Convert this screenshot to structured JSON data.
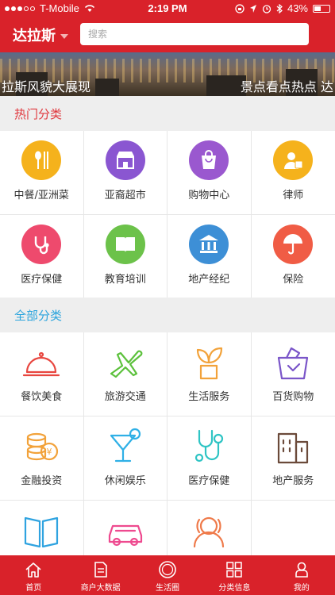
{
  "status": {
    "carrier": "T-Mobile",
    "time": "2:19 PM",
    "battery": "43%",
    "battery_level": 0.43
  },
  "header": {
    "city": "达拉斯",
    "search_placeholder": "搜索"
  },
  "banner": {
    "left_text": "拉斯风貌大展现",
    "right_text": "景点看点热点 达"
  },
  "hot": {
    "title": "热门分类",
    "title_color": "#e0383e",
    "items": [
      {
        "label": "中餐/亚洲菜",
        "icon": "spoon-chopsticks-icon",
        "color": "#f5b21c"
      },
      {
        "label": "亚裔超市",
        "icon": "store-icon",
        "color": "#8a56d1"
      },
      {
        "label": "购物中心",
        "icon": "shopping-bag-icon",
        "color": "#9a58cf"
      },
      {
        "label": "律师",
        "icon": "lawyer-icon",
        "color": "#f5b21c"
      },
      {
        "label": "医疗保健",
        "icon": "stethoscope-icon",
        "color": "#ee4a6d"
      },
      {
        "label": "教育培训",
        "icon": "book-icon",
        "color": "#6cc24a"
      },
      {
        "label": "地产经纪",
        "icon": "bank-icon",
        "color": "#3d8fd6"
      },
      {
        "label": "保险",
        "icon": "umbrella-icon",
        "color": "#f05c45"
      }
    ]
  },
  "all": {
    "title": "全部分类",
    "title_color": "#2aa4dd",
    "items": [
      {
        "label": "餐饮美食",
        "icon": "food-cloche-icon",
        "color": "#e8463f"
      },
      {
        "label": "旅游交通",
        "icon": "airplane-icon",
        "color": "#5cc13c"
      },
      {
        "label": "生活服务",
        "icon": "potted-plant-icon",
        "color": "#f2a23a"
      },
      {
        "label": "百货购物",
        "icon": "shopping-basket-icon",
        "color": "#7a55c9"
      },
      {
        "label": "金融投资",
        "icon": "coins-icon",
        "color": "#f2a23a"
      },
      {
        "label": "休闲娱乐",
        "icon": "cocktail-icon",
        "color": "#2fb0e6"
      },
      {
        "label": "医疗保健",
        "icon": "stethoscope-icon",
        "color": "#2ec4c4"
      },
      {
        "label": "地产服务",
        "icon": "building-icon",
        "color": "#6b4a3a"
      },
      {
        "label": "",
        "icon": "book-open-icon",
        "color": "#2fa3e0"
      },
      {
        "label": "",
        "icon": "car-icon",
        "color": "#ee4a8f"
      },
      {
        "label": "",
        "icon": "people-icon",
        "color": "#ef7a4a"
      }
    ]
  },
  "tabbar": {
    "items": [
      {
        "label": "首页",
        "icon": "home-icon"
      },
      {
        "label": "商户大数据",
        "icon": "document-icon"
      },
      {
        "label": "生活圈",
        "icon": "circle-icon"
      },
      {
        "label": "分类信息",
        "icon": "grid-icon"
      },
      {
        "label": "我的",
        "icon": "user-icon"
      }
    ]
  }
}
